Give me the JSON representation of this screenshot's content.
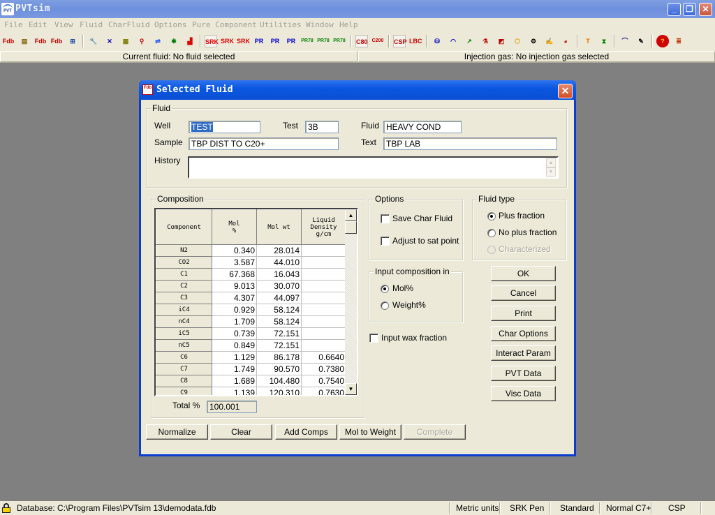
{
  "app": {
    "title": "PVTsim",
    "logo_text": "PVT",
    "window_buttons": {
      "minimize": "_",
      "maximize": "❐",
      "close": "✕"
    }
  },
  "menu": [
    "File",
    "Edit",
    "View",
    "Fluid",
    "CharFluid",
    "Options",
    "Pure Component",
    "Utilities",
    "Window",
    "Help"
  ],
  "toolbar": {
    "icons": [
      {
        "name": "new-fluid-icon",
        "glyph": "Fdb",
        "color": "#c00000"
      },
      {
        "name": "open-database-icon",
        "glyph": "▤",
        "color": "#806000"
      },
      {
        "name": "new-database-icon",
        "glyph": "Fdb",
        "color": "#c00000"
      },
      {
        "name": "add-fluid-icon",
        "glyph": "Fdb",
        "color": "#c00000"
      },
      {
        "name": "fluid-database-settings-icon",
        "glyph": "⊞",
        "color": "#2050a0"
      },
      {
        "name": "wrench-icon",
        "glyph": "🔧",
        "color": "#404040"
      },
      {
        "name": "mix-icon",
        "glyph": "✕",
        "color": "#0000c0"
      },
      {
        "name": "recombine-icon",
        "glyph": "▦",
        "color": "#808000"
      },
      {
        "name": "weave-icon",
        "glyph": "⚲",
        "color": "#d00000"
      },
      {
        "name": "mixing-icon",
        "glyph": "⇌",
        "color": "#0040ff"
      },
      {
        "name": "split-icon",
        "glyph": "✱",
        "color": "#008000"
      },
      {
        "name": "chart-icon",
        "glyph": "▟",
        "color": "#e00000"
      },
      {
        "name": "srk-pressed-icon",
        "glyph": "SRK",
        "color": "#e00000"
      },
      {
        "name": "srk-icon",
        "glyph": "SRK",
        "color": "#e00000"
      },
      {
        "name": "srk-peneloux-icon",
        "glyph": "SRK",
        "color": "#e00000"
      },
      {
        "name": "pr-icon",
        "glyph": "PR",
        "color": "#0000d0"
      },
      {
        "name": "pr-plain-icon",
        "glyph": "PR",
        "color": "#0000d0"
      },
      {
        "name": "pr-peneloux-icon",
        "glyph": "PR",
        "color": "#0000d0"
      },
      {
        "name": "pr78-icon",
        "glyph": "PR78",
        "color": "#008000"
      },
      {
        "name": "pr78-plain-icon",
        "glyph": "PR78",
        "color": "#008000"
      },
      {
        "name": "pr78-peneloux-icon",
        "glyph": "PR78",
        "color": "#008000"
      },
      {
        "name": "c80-icon",
        "glyph": "C80",
        "color": "#c00000"
      },
      {
        "name": "c200-icon",
        "glyph": "C200",
        "color": "#c00000"
      },
      {
        "name": "csp-icon",
        "glyph": "CSP",
        "color": "#c00000"
      },
      {
        "name": "lbc-icon",
        "glyph": "LBC",
        "color": "#d00000"
      },
      {
        "name": "separator-icon",
        "glyph": "⛁",
        "color": "#0000c0"
      },
      {
        "name": "phase-envelope-icon",
        "glyph": "◠",
        "color": "#0000c0"
      },
      {
        "name": "flash-icon",
        "glyph": "↗",
        "color": "#008000"
      },
      {
        "name": "injection-icon",
        "glyph": "⚗",
        "color": "#c00000"
      },
      {
        "name": "asphaltene-icon",
        "glyph": "◩",
        "color": "#c00000"
      },
      {
        "name": "hydrate-icon",
        "glyph": "⬡",
        "color": "#e0a000"
      },
      {
        "name": "wax-icon",
        "glyph": "⚙",
        "color": "#000000"
      },
      {
        "name": "scale-icon",
        "glyph": "✍",
        "color": "#404040"
      },
      {
        "name": "pipe-icon",
        "glyph": "◕",
        "color": "#c00000"
      },
      {
        "name": "temperature-icon",
        "glyph": "T",
        "color": "#e07000"
      },
      {
        "name": "regression-icon",
        "glyph": "⧗",
        "color": "#008000"
      },
      {
        "name": "envelope-curve-icon",
        "glyph": "⌒",
        "color": "#000080"
      },
      {
        "name": "probe-icon",
        "glyph": "✎",
        "color": "#000000"
      },
      {
        "name": "help-icon",
        "glyph": "?",
        "color": "#d00000"
      },
      {
        "name": "about-icon",
        "glyph": "≣",
        "color": "#c03000"
      }
    ]
  },
  "fluid_bar": {
    "current_fluid": "Current fluid: No fluid selected",
    "injection_gas": "Injection gas: No injection gas selected"
  },
  "dialog": {
    "title": "Selected Fluid",
    "icon_text": "Fdb",
    "close": "✕",
    "fluid_group": {
      "legend": "Fluid",
      "well_label": "Well",
      "well_value": "TEST",
      "test_label": "Test",
      "test_value": "3B",
      "fluid_label": "Fluid",
      "fluid_value": "HEAVY COND",
      "sample_label": "Sample",
      "sample_value": "TBP DIST TO C20+",
      "text_label": "Text",
      "text_value": "TBP LAB",
      "history_label": "History",
      "history_value": ""
    },
    "composition": {
      "legend": "Composition",
      "columns": [
        "Component",
        "Mol %",
        "Mol wt",
        "Liquid Density g/cm"
      ],
      "header_lines": {
        "component": "Component",
        "mol_pct_1": "Mol",
        "mol_pct_2": "%",
        "mol_wt": "Mol wt",
        "density_1": "Liquid",
        "density_2": "Density",
        "density_3": "g/cm"
      },
      "rows": [
        {
          "component": "N2",
          "mol_pct": "0.340",
          "mol_wt": "28.014",
          "density": ""
        },
        {
          "component": "CO2",
          "mol_pct": "3.587",
          "mol_wt": "44.010",
          "density": ""
        },
        {
          "component": "C1",
          "mol_pct": "67.368",
          "mol_wt": "16.043",
          "density": ""
        },
        {
          "component": "C2",
          "mol_pct": "9.013",
          "mol_wt": "30.070",
          "density": ""
        },
        {
          "component": "C3",
          "mol_pct": "4.307",
          "mol_wt": "44.097",
          "density": ""
        },
        {
          "component": "iC4",
          "mol_pct": "0.929",
          "mol_wt": "58.124",
          "density": ""
        },
        {
          "component": "nC4",
          "mol_pct": "1.709",
          "mol_wt": "58.124",
          "density": ""
        },
        {
          "component": "iC5",
          "mol_pct": "0.739",
          "mol_wt": "72.151",
          "density": ""
        },
        {
          "component": "nC5",
          "mol_pct": "0.849",
          "mol_wt": "72.151",
          "density": ""
        },
        {
          "component": "C6",
          "mol_pct": "1.129",
          "mol_wt": "86.178",
          "density": "0.6640"
        },
        {
          "component": "C7",
          "mol_pct": "1.749",
          "mol_wt": "90.570",
          "density": "0.7380"
        },
        {
          "component": "C8",
          "mol_pct": "1.689",
          "mol_wt": "104.480",
          "density": "0.7540"
        },
        {
          "component": "C9",
          "mol_pct": "1.139",
          "mol_wt": "120.310",
          "density": "0.7630"
        }
      ],
      "total_label": "Total %",
      "total_value": "100.001"
    },
    "options": {
      "legend": "Options",
      "save_char_fluid": {
        "label": "Save Char Fluid",
        "checked": false
      },
      "adjust_sat_point": {
        "label": "Adjust to sat point",
        "checked": false
      }
    },
    "fluid_type": {
      "legend": "Fluid type",
      "options": [
        {
          "label": "Plus fraction",
          "selected": true,
          "enabled": true
        },
        {
          "label": "No plus fraction",
          "selected": false,
          "enabled": true
        },
        {
          "label": "Characterized",
          "selected": false,
          "enabled": false
        }
      ]
    },
    "input_composition": {
      "legend": "Input composition in",
      "options": [
        {
          "label": "Mol%",
          "selected": true
        },
        {
          "label": "Weight%",
          "selected": false
        }
      ]
    },
    "input_wax_fraction": {
      "label": "Input wax fraction",
      "checked": false
    },
    "side_buttons": [
      "OK",
      "Cancel",
      "Print",
      "Char Options",
      "Interact Param",
      "PVT Data",
      "Visc Data"
    ],
    "bottom_buttons": [
      {
        "label": "Normalize",
        "enabled": true
      },
      {
        "label": "Clear",
        "enabled": true
      },
      {
        "label": "Add Comps",
        "enabled": true
      },
      {
        "label": "Mol to Weight",
        "enabled": true
      },
      {
        "label": "Complete",
        "enabled": false
      }
    ]
  },
  "status_bar": {
    "database": "Database: C:\\Program Files\\PVTsim 13\\demodata.fdb",
    "units": "Metric units",
    "eos": "SRK Pen",
    "mode": "Standard",
    "c7_plus": "Normal C7+",
    "viscosity": "CSP"
  }
}
